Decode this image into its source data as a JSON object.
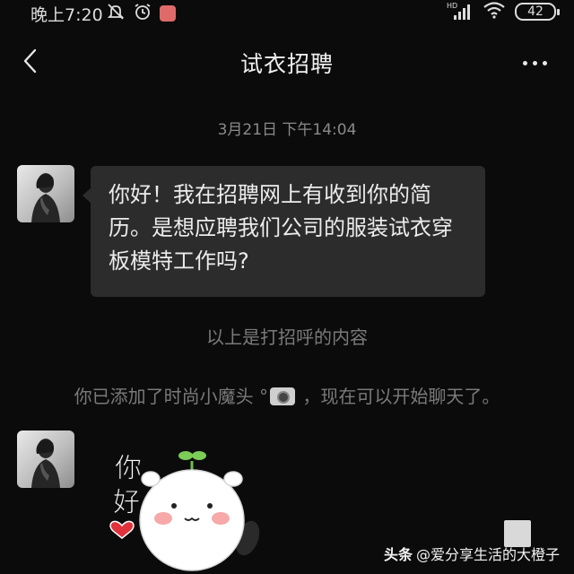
{
  "status_bar": {
    "time": "晚上7:20",
    "left_icons": [
      "bell-off-icon",
      "alarm-icon",
      "app-notification-icon"
    ],
    "right_icons": [
      "hd-signal-icon",
      "wifi-icon",
      "battery-icon"
    ],
    "hd_label": "HD",
    "battery": "42"
  },
  "header": {
    "title": "试衣招聘",
    "back_icon": "chevron-left-icon",
    "more_icon": "more-dots-icon"
  },
  "chat": {
    "timestamp": "3月21日 下午14:04",
    "messages": [
      {
        "sender": "other",
        "text": "你好！我在招聘网上有收到你的简历。是想应聘我们公司的服装试衣穿板模特工作吗?"
      }
    ],
    "system_msg_greeting": "以上是打招呼的内容",
    "system_msg_added_before": "你已添加了时尚小魔头",
    "system_msg_added_after": "，现在可以开始聊天了。",
    "sticker": {
      "type": "panda-hello-sticker",
      "caption": "你好"
    }
  },
  "watermark": {
    "brand": "头条",
    "handle": "@爱分享生活的大橙子"
  },
  "colors": {
    "background": "#0b0b0b",
    "bubble": "#2c2c2c",
    "system_text": "#7a7a7a",
    "heart": "#e0323b"
  }
}
